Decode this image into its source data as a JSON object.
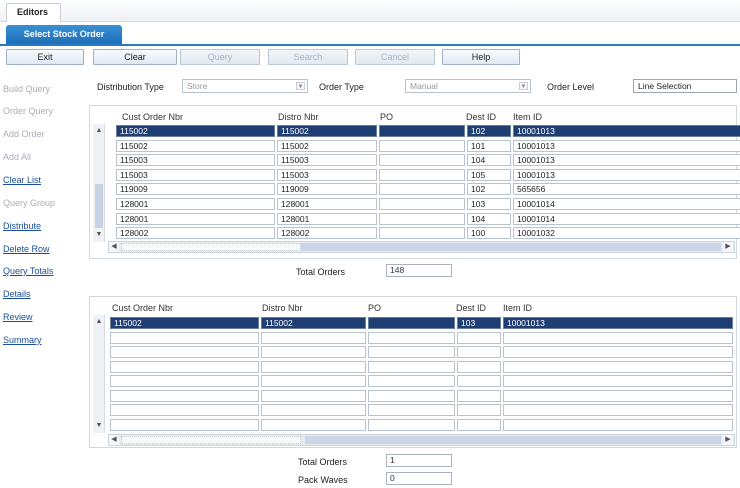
{
  "window": {
    "tab_label": "Editors"
  },
  "screen_tab": "Select Stock Order",
  "toolbar": {
    "buttons": [
      {
        "label": "Exit",
        "enabled": true
      },
      {
        "label": "Clear",
        "enabled": true
      },
      {
        "label": "Query",
        "enabled": false
      },
      {
        "label": "Search",
        "enabled": false
      },
      {
        "label": "Cancel",
        "enabled": false
      },
      {
        "label": "Help",
        "enabled": true
      }
    ]
  },
  "sidebar": {
    "items": [
      {
        "label": "Build Query",
        "enabled": false
      },
      {
        "label": "Order Query",
        "enabled": false
      },
      {
        "label": "Add Order",
        "enabled": false
      },
      {
        "label": "Add All",
        "enabled": false
      },
      {
        "label": "Clear List",
        "enabled": true
      },
      {
        "label": "Query Group",
        "enabled": false
      },
      {
        "label": "Distribute",
        "enabled": true
      },
      {
        "label": "Delete Row",
        "enabled": true
      },
      {
        "label": "Query Totals",
        "enabled": true
      },
      {
        "label": "Details",
        "enabled": true
      },
      {
        "label": "Review",
        "enabled": true
      },
      {
        "label": "Summary",
        "enabled": true
      }
    ]
  },
  "filters": {
    "distribution_type": {
      "label": "Distribution Type",
      "value": "Store"
    },
    "order_type": {
      "label": "Order Type",
      "value": "Manual"
    },
    "order_level": {
      "label": "Order Level",
      "value": "Line Selection"
    }
  },
  "top_grid": {
    "columns": [
      "Cust Order Nbr",
      "Distro Nbr",
      "PO",
      "Dest ID",
      "Item ID"
    ],
    "rows": [
      [
        "115002",
        "115002",
        "",
        "102",
        "10001013"
      ],
      [
        "115002",
        "115002",
        "",
        "101",
        "10001013"
      ],
      [
        "115003",
        "115003",
        "",
        "104",
        "10001013"
      ],
      [
        "115003",
        "115003",
        "",
        "105",
        "10001013"
      ],
      [
        "119009",
        "119009",
        "",
        "102",
        "565656"
      ],
      [
        "128001",
        "128001",
        "",
        "103",
        "10001014"
      ],
      [
        "128001",
        "128001",
        "",
        "104",
        "10001014"
      ],
      [
        "128002",
        "128002",
        "",
        "100",
        "10001032"
      ]
    ],
    "selected_row": 0,
    "total_label": "Total Orders",
    "total_value": "148"
  },
  "bottom_grid": {
    "columns": [
      "Cust Order Nbr",
      "Distro Nbr",
      "PO",
      "Dest ID",
      "Item ID"
    ],
    "rows": [
      [
        "115002",
        "115002",
        "",
        "103",
        "10001013"
      ],
      [
        "",
        "",
        "",
        "",
        ""
      ],
      [
        "",
        "",
        "",
        "",
        ""
      ],
      [
        "",
        "",
        "",
        "",
        ""
      ],
      [
        "",
        "",
        "",
        "",
        ""
      ],
      [
        "",
        "",
        "",
        "",
        ""
      ],
      [
        "",
        "",
        "",
        "",
        ""
      ],
      [
        "",
        "",
        "",
        "",
        ""
      ]
    ],
    "selected_row": 0,
    "total_orders_label": "Total Orders",
    "total_orders_value": "1",
    "pack_waves_label": "Pack Waves",
    "pack_waves_value": "0"
  }
}
